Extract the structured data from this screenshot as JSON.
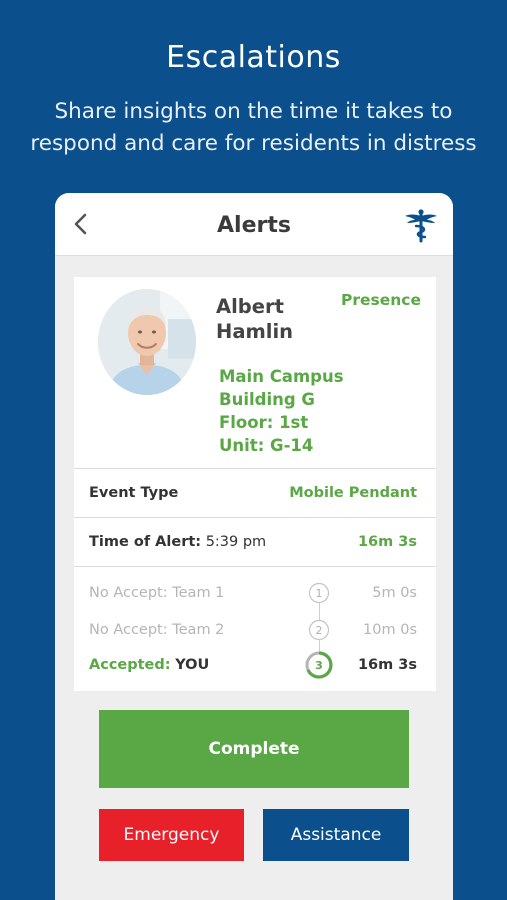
{
  "promo": {
    "headline": "Escalations",
    "subline": "Share insights on the time it takes to respond and care for residents in distress"
  },
  "topbar": {
    "title": "Alerts",
    "back_icon": "chevron-left-icon",
    "logo_icon": "caduceus-logo-icon"
  },
  "resident": {
    "name": "Albert Hamlin",
    "status": "Presence",
    "location": {
      "campus": "Main Campus",
      "building": "Building G",
      "floor": "Floor: 1st",
      "unit": "Unit: G-14"
    }
  },
  "event": {
    "label": "Event Type",
    "value": "Mobile Pendant"
  },
  "time_of_alert": {
    "label": "Time of Alert:",
    "time": "5:39 pm",
    "elapsed": "16m 3s"
  },
  "escalation": [
    {
      "label": "No Accept: Team 1",
      "step": "1",
      "time": "5m 0s"
    },
    {
      "label": "No Accept: Team 2",
      "step": "2",
      "time": "10m 0s"
    },
    {
      "label": "Accepted:",
      "who": "YOU",
      "step": "3",
      "time": "16m 3s"
    }
  ],
  "actions": {
    "complete": "Complete",
    "emergency": "Emergency",
    "assistance": "Assistance"
  },
  "colors": {
    "brand_blue": "#0b4f8c",
    "green": "#5aa845",
    "red": "#e8202a"
  }
}
